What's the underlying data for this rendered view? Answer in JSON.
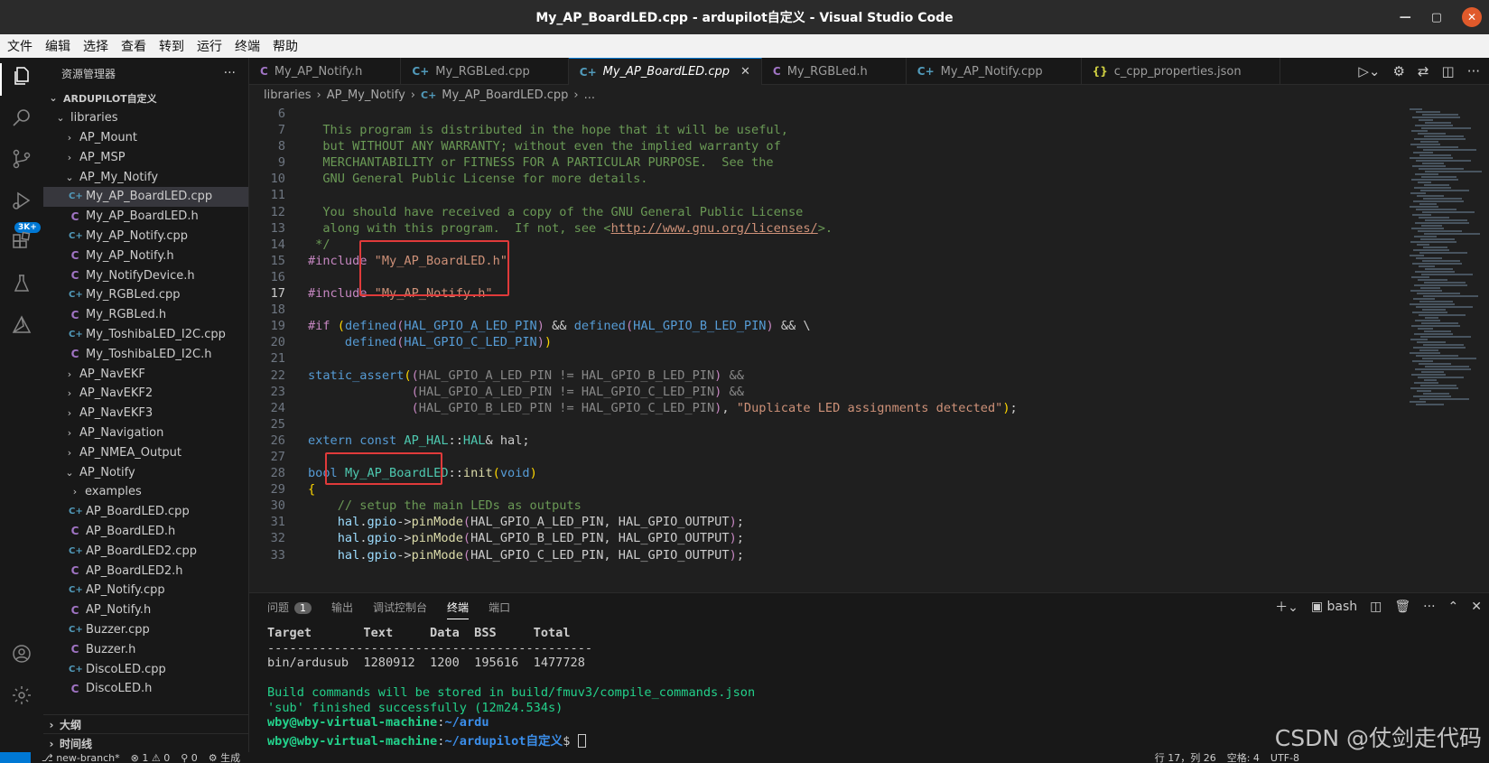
{
  "window": {
    "title": "My_AP_BoardLED.cpp - ardupilot自定义 - Visual Studio Code"
  },
  "menu": [
    "文件",
    "编辑",
    "选择",
    "查看",
    "转到",
    "运行",
    "终端",
    "帮助"
  ],
  "activity": {
    "scm_badge": "3K+"
  },
  "sidebar": {
    "header": "资源管理器",
    "root": "ARDUPILOT自定义",
    "libraries": "libraries",
    "items": [
      {
        "label": "AP_Mount",
        "type": "folder",
        "indent": 1
      },
      {
        "label": "AP_MSP",
        "type": "folder",
        "indent": 1
      },
      {
        "label": "AP_My_Notify",
        "type": "folder-open",
        "indent": 1
      },
      {
        "label": "My_AP_BoardLED.cpp",
        "type": "cpp",
        "indent": 2,
        "selected": true
      },
      {
        "label": "My_AP_BoardLED.h",
        "type": "h",
        "indent": 2
      },
      {
        "label": "My_AP_Notify.cpp",
        "type": "cpp",
        "indent": 2
      },
      {
        "label": "My_AP_Notify.h",
        "type": "h",
        "indent": 2
      },
      {
        "label": "My_NotifyDevice.h",
        "type": "h",
        "indent": 2
      },
      {
        "label": "My_RGBLed.cpp",
        "type": "cpp",
        "indent": 2
      },
      {
        "label": "My_RGBLed.h",
        "type": "h",
        "indent": 2
      },
      {
        "label": "My_ToshibaLED_I2C.cpp",
        "type": "cpp",
        "indent": 2
      },
      {
        "label": "My_ToshibaLED_I2C.h",
        "type": "h",
        "indent": 2
      },
      {
        "label": "AP_NavEKF",
        "type": "folder",
        "indent": 1
      },
      {
        "label": "AP_NavEKF2",
        "type": "folder",
        "indent": 1
      },
      {
        "label": "AP_NavEKF3",
        "type": "folder",
        "indent": 1
      },
      {
        "label": "AP_Navigation",
        "type": "folder",
        "indent": 1
      },
      {
        "label": "AP_NMEA_Output",
        "type": "folder",
        "indent": 1
      },
      {
        "label": "AP_Notify",
        "type": "folder-open",
        "indent": 1
      },
      {
        "label": "examples",
        "type": "folder",
        "indent": 2
      },
      {
        "label": "AP_BoardLED.cpp",
        "type": "cpp",
        "indent": 2
      },
      {
        "label": "AP_BoardLED.h",
        "type": "h",
        "indent": 2
      },
      {
        "label": "AP_BoardLED2.cpp",
        "type": "cpp",
        "indent": 2
      },
      {
        "label": "AP_BoardLED2.h",
        "type": "h",
        "indent": 2
      },
      {
        "label": "AP_Notify.cpp",
        "type": "cpp",
        "indent": 2
      },
      {
        "label": "AP_Notify.h",
        "type": "h",
        "indent": 2
      },
      {
        "label": "Buzzer.cpp",
        "type": "cpp",
        "indent": 2
      },
      {
        "label": "Buzzer.h",
        "type": "h",
        "indent": 2
      },
      {
        "label": "DiscoLED.cpp",
        "type": "cpp",
        "indent": 2
      },
      {
        "label": "DiscoLED.h",
        "type": "h",
        "indent": 2
      }
    ],
    "outline": "大纲",
    "timeline": "时间线"
  },
  "tabs": [
    {
      "label": "My_AP_Notify.h",
      "icon": "C",
      "type": "h"
    },
    {
      "label": "My_RGBLed.cpp",
      "icon": "C+",
      "type": "cpp"
    },
    {
      "label": "My_AP_BoardLED.cpp",
      "icon": "C+",
      "type": "cpp",
      "active": true
    },
    {
      "label": "My_RGBLed.h",
      "icon": "C",
      "type": "h"
    },
    {
      "label": "My_AP_Notify.cpp",
      "icon": "C+",
      "type": "cpp"
    },
    {
      "label": "c_cpp_properties.json",
      "icon": "{}",
      "type": "json"
    }
  ],
  "breadcrumb": [
    "libraries",
    "AP_My_Notify",
    "My_AP_BoardLED.cpp",
    "..."
  ],
  "editor": {
    "current_line": 17,
    "lines": [
      {
        "n": 6,
        "html": ""
      },
      {
        "n": 7,
        "html": "<span class='c-com'>  This program is distributed in the hope that it will be useful,</span>"
      },
      {
        "n": 8,
        "html": "<span class='c-com'>  but WITHOUT ANY WARRANTY; without even the implied warranty of</span>"
      },
      {
        "n": 9,
        "html": "<span class='c-com'>  MERCHANTABILITY or FITNESS FOR A PARTICULAR PURPOSE.  See the</span>"
      },
      {
        "n": 10,
        "html": "<span class='c-com'>  GNU General Public License for more details.</span>"
      },
      {
        "n": 11,
        "html": ""
      },
      {
        "n": 12,
        "html": "<span class='c-com'>  You should have received a copy of the GNU General Public License</span>"
      },
      {
        "n": 13,
        "html": "<span class='c-com'>  along with this program.  If not, see &lt;</span><span class='c-link'>http://www.gnu.org/licenses/</span><span class='c-com'>&gt;.</span>"
      },
      {
        "n": 14,
        "html": "<span class='c-com'> */</span>"
      },
      {
        "n": 15,
        "html": "<span class='c-pp'>#include</span> <span class='c-str'>\"My_AP_BoardLED.h\"</span>"
      },
      {
        "n": 16,
        "html": ""
      },
      {
        "n": 17,
        "html": "<span class='c-pp'>#include</span> <span class='c-str'>\"My_AP_Notify.h\"</span>"
      },
      {
        "n": 18,
        "html": ""
      },
      {
        "n": 19,
        "html": "<span class='c-pp'>#if</span> <span class='c-yel'>(</span><span class='c-kw'>defined</span><span class='c-kw2'>(</span><span class='c-mac'>HAL_GPIO_A_LED_PIN</span><span class='c-kw2'>)</span> &amp;&amp; <span class='c-kw'>defined</span><span class='c-kw2'>(</span><span class='c-mac'>HAL_GPIO_B_LED_PIN</span><span class='c-kw2'>)</span> &amp;&amp; \\"
      },
      {
        "n": 20,
        "html": "     <span class='c-kw'>defined</span><span class='c-kw2'>(</span><span class='c-mac'>HAL_GPIO_C_LED_PIN</span><span class='c-kw2'>)</span><span class='c-yel'>)</span>"
      },
      {
        "n": 21,
        "html": ""
      },
      {
        "n": 22,
        "html": "<span class='c-kw'>static_assert</span><span class='c-yel'>(</span><span class='c-kw2'>(</span><span style='color:#888'>HAL_GPIO_A_LED_PIN != HAL_GPIO_B_LED_PIN</span><span class='c-kw2'>)</span> <span style='color:#888'>&amp;&amp;</span>"
      },
      {
        "n": 23,
        "html": "              <span class='c-kw2'>(</span><span style='color:#888'>HAL_GPIO_A_LED_PIN != HAL_GPIO_C_LED_PIN</span><span class='c-kw2'>)</span> <span style='color:#888'>&amp;&amp;</span>"
      },
      {
        "n": 24,
        "html": "              <span class='c-kw2'>(</span><span style='color:#888'>HAL_GPIO_B_LED_PIN != HAL_GPIO_C_LED_PIN</span><span class='c-kw2'>)</span>, <span class='c-str'>\"Duplicate LED assignments detected\"</span><span class='c-yel'>)</span>;"
      },
      {
        "n": 25,
        "html": ""
      },
      {
        "n": 26,
        "html": "<span class='c-kw'>extern</span> <span class='c-kw'>const</span> <span class='c-type'>AP_HAL</span>::<span class='c-type'>HAL</span>&amp; hal;"
      },
      {
        "n": 27,
        "html": ""
      },
      {
        "n": 28,
        "html": "<span class='c-kw'>bool</span> <span class='c-type'>My_AP_BoardLED</span>::<span class='c-fn'>init</span><span class='c-yel'>(</span><span class='c-kw'>void</span><span class='c-yel'>)</span>"
      },
      {
        "n": 29,
        "html": "<span class='c-yel'>{</span>"
      },
      {
        "n": 30,
        "html": "    <span class='c-com'>// setup the main LEDs as outputs</span>"
      },
      {
        "n": 31,
        "html": "    <span class='c-var'>hal</span>.<span class='c-var'>gpio</span>-&gt;<span class='c-fn'>pinMode</span><span class='c-kw2'>(</span>HAL_GPIO_A_LED_PIN, HAL_GPIO_OUTPUT<span class='c-kw2'>)</span>;"
      },
      {
        "n": 32,
        "html": "    <span class='c-var'>hal</span>.<span class='c-var'>gpio</span>-&gt;<span class='c-fn'>pinMode</span><span class='c-kw2'>(</span>HAL_GPIO_B_LED_PIN, HAL_GPIO_OUTPUT<span class='c-kw2'>)</span>;"
      },
      {
        "n": 33,
        "html": "    <span class='c-var'>hal</span>.<span class='c-var'>gpio</span>-&gt;<span class='c-fn'>pinMode</span><span class='c-kw2'>(</span>HAL_GPIO_C_LED_PIN, HAL_GPIO_OUTPUT<span class='c-kw2'>)</span>;"
      }
    ]
  },
  "panel": {
    "tabs": [
      "问题",
      "输出",
      "调试控制台",
      "终端",
      "端口"
    ],
    "problems_count": "1",
    "active_tab": "终端",
    "shell": "bash",
    "terminal_lines": [
      {
        "text": "Target       Text     Data  BSS     Total",
        "cls": "bold"
      },
      {
        "text": "--------------------------------------------",
        "cls": ""
      },
      {
        "text": "bin/ardusub  1280912  1200  195616  1477728",
        "cls": ""
      },
      {
        "text": "",
        "cls": ""
      },
      {
        "text": "Build commands will be stored in build/fmuv3/compile_commands.json",
        "cls": "tg"
      },
      {
        "text": "'sub' finished successfully (12m24.534s)",
        "cls": "tg"
      }
    ],
    "prompt1_user": "wby@wby-virtual-machine",
    "prompt1_path": "~/ardu",
    "prompt2_user": "wby@wby-virtual-machine",
    "prompt2_path": "~/ardupilot自定义",
    "prompt_sym": "$"
  },
  "statusbar": {
    "branch": "new-branch*",
    "errors": "⊗ 1 ⚠ 0",
    "ports": "⚲ 0",
    "build": "⚙ 生成",
    "position": "行 17，列 26",
    "spaces": "空格: 4",
    "encoding": "UTF-8"
  },
  "watermark": "CSDN @仗剑走代码"
}
